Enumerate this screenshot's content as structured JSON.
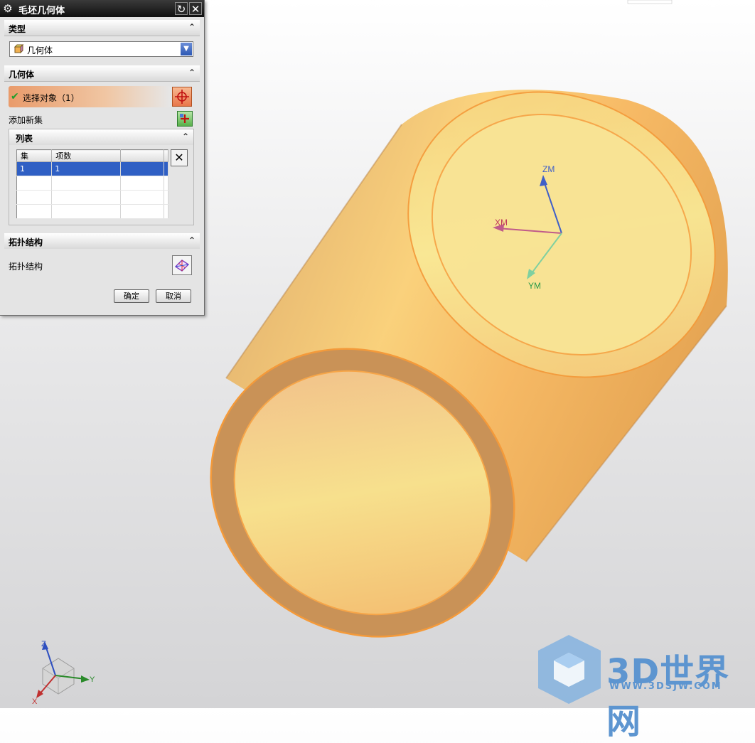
{
  "dialog": {
    "title": "毛坯几何体",
    "sections": {
      "type_label": "类型",
      "geometry_label": "几何体",
      "topology_label": "拓扑结构"
    },
    "type_value": "几何体",
    "select_object": "选择对象（1）",
    "add_new_set": "添加新集",
    "list": {
      "label": "列表",
      "columns": [
        "集",
        "项数",
        "",
        ""
      ],
      "rows": [
        [
          "1",
          "1",
          "",
          ""
        ],
        [
          "",
          "",
          "",
          ""
        ],
        [
          "",
          "",
          "",
          ""
        ],
        [
          "",
          "",
          "",
          ""
        ]
      ]
    },
    "topology_field": "拓扑结构",
    "ok": "确定",
    "cancel": "取消"
  },
  "viewport": {
    "wcs": {
      "zm": "ZM",
      "xm": "XM",
      "ym": "YM"
    },
    "triad": {
      "z": "Z",
      "y": "Y",
      "x": "X"
    }
  },
  "watermark": {
    "logo": "3D世界网",
    "url": "WWW.3DSJW.COM"
  },
  "colors": {
    "part": "#f6a94b",
    "accent": "#2f5fc4"
  }
}
